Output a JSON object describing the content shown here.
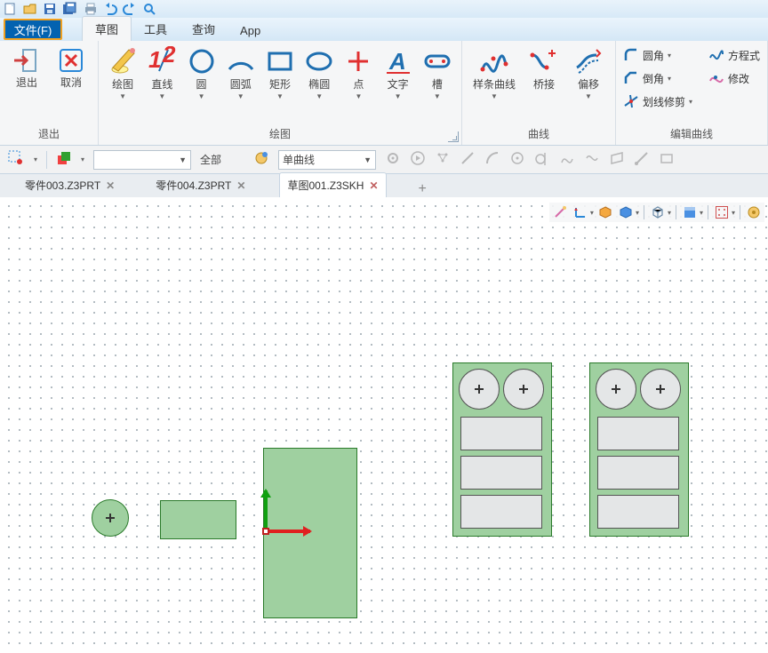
{
  "menu": {
    "file": "文件(F)",
    "tabs": [
      "草图",
      "工具",
      "查询",
      "App"
    ],
    "active_tab": "草图"
  },
  "ribbon": {
    "exit_group": {
      "title": "退出",
      "exit": "退出",
      "cancel": "取消"
    },
    "draw_group": {
      "title": "绘图",
      "draw": "绘图",
      "line": "直线",
      "circle": "圆",
      "arc": "圆弧",
      "rect": "矩形",
      "ellipse": "椭圆",
      "point": "点",
      "text": "文字",
      "slot": "槽"
    },
    "curve_group": {
      "title": "曲线",
      "spline": "样条曲线",
      "bridge": "桥接",
      "offset": "偏移"
    },
    "edit_group": {
      "title": "编辑曲线",
      "fillet": "圆角",
      "chamfer": "倒角",
      "trim": "划线修剪",
      "equation": "方程式",
      "modify": "修改"
    }
  },
  "toolbar2": {
    "all": "全部",
    "entity_filter": "单曲线"
  },
  "doc_tabs": {
    "tabs": [
      {
        "label": "零件003.Z3PRT",
        "active": false
      },
      {
        "label": "零件004.Z3PRT",
        "active": false
      },
      {
        "label": "草图001.Z3SKH",
        "active": true
      }
    ]
  }
}
